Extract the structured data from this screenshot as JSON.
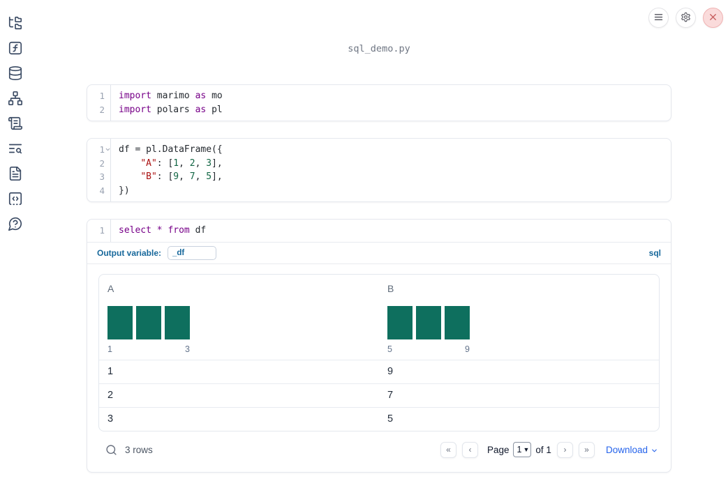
{
  "colors": {
    "accent_blue": "#17689b",
    "link_blue": "#2563eb",
    "bar_teal": "#0e6f5e",
    "code_keyword": "#770088",
    "code_string": "#aa1111",
    "code_number": "#116644"
  },
  "sidebar": {
    "items": [
      {
        "name": "file-explorer",
        "icon": "folder-tree-icon"
      },
      {
        "name": "variables",
        "icon": "function-square-icon"
      },
      {
        "name": "data-sources",
        "icon": "database-icon"
      },
      {
        "name": "dependency-graph",
        "icon": "network-icon"
      },
      {
        "name": "logs",
        "icon": "scroll-text-icon"
      },
      {
        "name": "outline",
        "icon": "text-search-icon"
      },
      {
        "name": "documentation",
        "icon": "file-text-icon"
      },
      {
        "name": "snippets",
        "icon": "code-square-icon"
      },
      {
        "name": "help",
        "icon": "help-circle-icon"
      }
    ]
  },
  "topbar": {
    "menu_button": "menu",
    "settings_button": "settings",
    "close_button": "close"
  },
  "header": {
    "filename": "sql_demo.py"
  },
  "cells": [
    {
      "type": "python",
      "lines": [
        {
          "num": "1",
          "tokens": [
            [
              "kw",
              "import"
            ],
            [
              "pl",
              " marimo "
            ],
            [
              "kw",
              "as"
            ],
            [
              "pl",
              " mo"
            ]
          ]
        },
        {
          "num": "2",
          "tokens": [
            [
              "kw",
              "import"
            ],
            [
              "pl",
              " polars "
            ],
            [
              "kw",
              "as"
            ],
            [
              "pl",
              " pl"
            ]
          ]
        }
      ]
    },
    {
      "type": "python",
      "lines": [
        {
          "num": "1",
          "fold": true,
          "tokens": [
            [
              "pl",
              "df = pl.DataFrame({"
            ]
          ]
        },
        {
          "num": "2",
          "tokens": [
            [
              "pl",
              "    "
            ],
            [
              "str",
              "\"A\""
            ],
            [
              "pl",
              ": ["
            ],
            [
              "num",
              "1"
            ],
            [
              "pl",
              ", "
            ],
            [
              "num",
              "2"
            ],
            [
              "pl",
              ", "
            ],
            [
              "num",
              "3"
            ],
            [
              "pl",
              "],"
            ]
          ]
        },
        {
          "num": "3",
          "tokens": [
            [
              "pl",
              "    "
            ],
            [
              "str",
              "\"B\""
            ],
            [
              "pl",
              ": ["
            ],
            [
              "num",
              "9"
            ],
            [
              "pl",
              ", "
            ],
            [
              "num",
              "7"
            ],
            [
              "pl",
              ", "
            ],
            [
              "num",
              "5"
            ],
            [
              "pl",
              "],"
            ]
          ]
        },
        {
          "num": "4",
          "tokens": [
            [
              "pl",
              "})"
            ]
          ]
        }
      ]
    },
    {
      "type": "sql",
      "lines": [
        {
          "num": "1",
          "tokens": [
            [
              "kw",
              "select"
            ],
            [
              "pl",
              " "
            ],
            [
              "kw",
              "*"
            ],
            [
              "pl",
              " "
            ],
            [
              "kw",
              "from"
            ],
            [
              "pl",
              " df"
            ]
          ]
        }
      ],
      "output_variable": {
        "label": "Output variable:",
        "value": "_df"
      },
      "language_badge": "sql"
    }
  ],
  "table": {
    "columns": [
      {
        "name": "A",
        "ticks": [
          "1",
          "3"
        ],
        "histogram": [
          1,
          1,
          1
        ]
      },
      {
        "name": "B",
        "ticks": [
          "5",
          "9"
        ],
        "histogram": [
          1,
          1,
          1
        ]
      }
    ],
    "rows": [
      [
        "1",
        "9"
      ],
      [
        "2",
        "7"
      ],
      [
        "3",
        "5"
      ]
    ],
    "footer": {
      "row_count": "3 rows",
      "page_label": "Page",
      "page_value": "1",
      "of_label": "of 1",
      "download_label": "Download"
    }
  }
}
